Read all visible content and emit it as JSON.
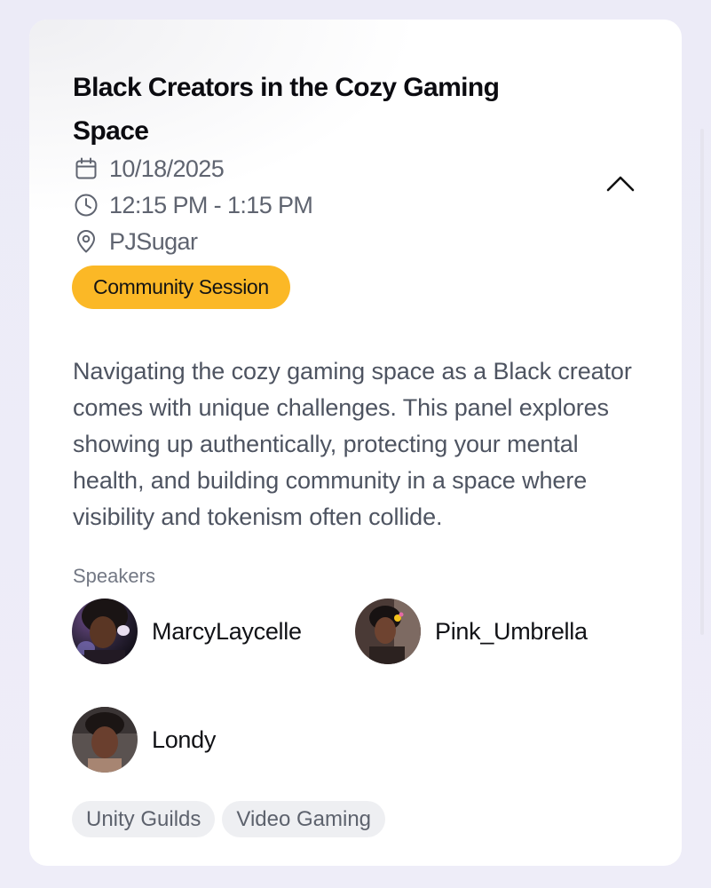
{
  "session": {
    "title": "Black Creators in the Cozy Gaming Space",
    "date": "10/18/2025",
    "time": "12:15 PM - 1:15 PM",
    "location": "PJSugar",
    "type_badge": "Community Session",
    "description": "Navigating the cozy gaming space as a Black creator comes with unique challenges. This panel explores showing up authentically, protecting your mental health, and building community in a space where visibility and tokenism often collide."
  },
  "icons": {
    "date": "calendar-icon",
    "time": "clock-icon",
    "location": "map-pin-icon",
    "collapse": "chevron-up-icon"
  },
  "speakers": {
    "label": "Speakers",
    "items": [
      {
        "name": "MarcyLaycelle"
      },
      {
        "name": "Pink_Umbrella"
      },
      {
        "name": "Londy"
      }
    ]
  },
  "tags": [
    {
      "label": "Unity Guilds"
    },
    {
      "label": "Video Gaming"
    }
  ],
  "colors": {
    "badge": "#fbb826",
    "title": "#0b0b10",
    "meta": "#5f6470",
    "tag_bg": "#eeeff2"
  }
}
